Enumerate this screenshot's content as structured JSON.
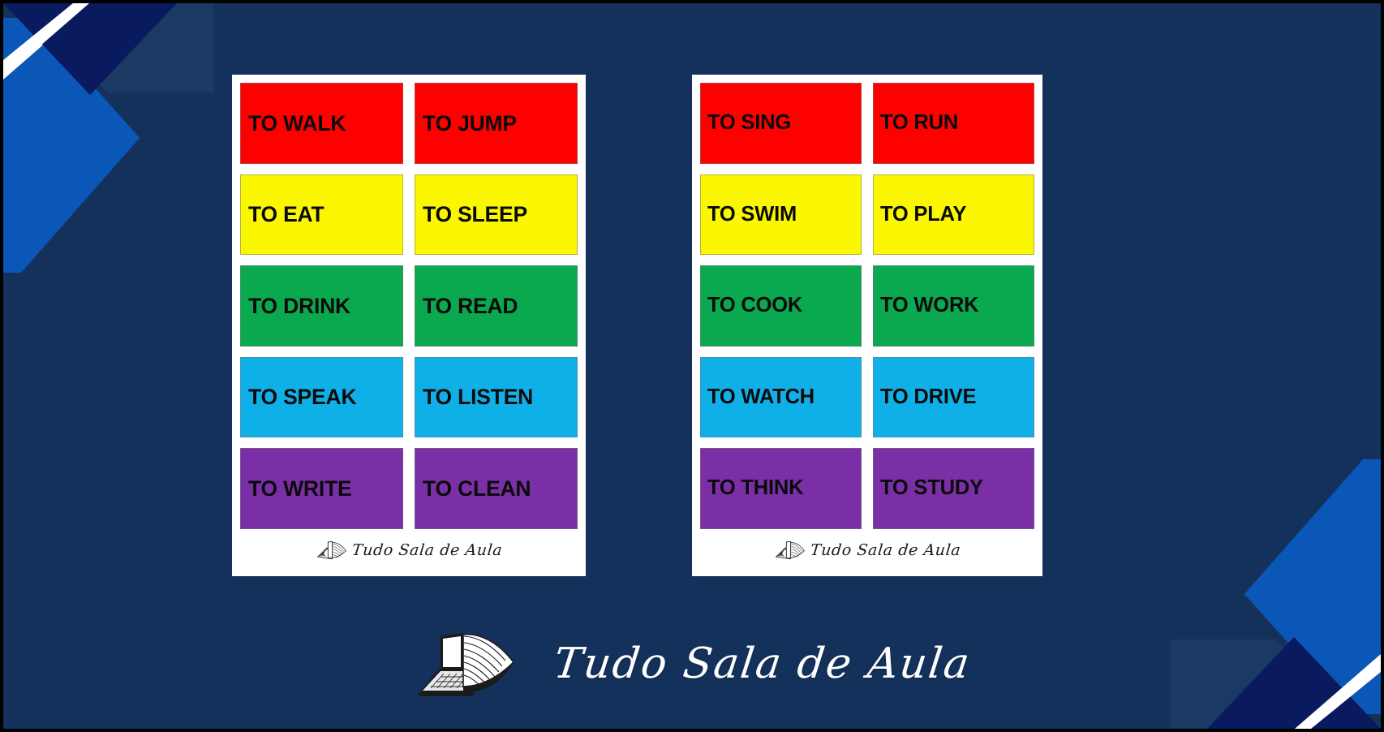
{
  "theme": {
    "background": "#14315c",
    "card_background": "#ffffff",
    "frame_border": "#000000",
    "corner_navy": "#0a1a5e",
    "corner_blue": "#0a57b8",
    "corner_white_stripe": "#ffffff",
    "corner_dark_panel": "#1b3a63"
  },
  "palette": {
    "red": "#ff0000",
    "yellow": "#fbf700",
    "green": "#0aa84f",
    "cyan": "#0fb0e8",
    "purple": "#7b2fa6"
  },
  "brand": {
    "name": "Tudo Sala de Aula",
    "logo_icon": "laptop-open-book-icon"
  },
  "cards": [
    {
      "id": "card-left",
      "watermark": {
        "text": "Tudo Sala de Aula",
        "icon": "open-book-icon"
      },
      "rows": [
        {
          "color": "red",
          "left": "TO WALK",
          "right": "TO JUMP"
        },
        {
          "color": "yellow",
          "left": "TO EAT",
          "right": "TO SLEEP"
        },
        {
          "color": "green",
          "left": "TO DRINK",
          "right": "TO READ"
        },
        {
          "color": "cyan",
          "left": "TO SPEAK",
          "right": "TO LISTEN"
        },
        {
          "color": "purple",
          "left": "TO WRITE",
          "right": "TO CLEAN"
        }
      ]
    },
    {
      "id": "card-right",
      "watermark": {
        "text": "Tudo Sala de Aula",
        "icon": "open-book-icon"
      },
      "rows": [
        {
          "color": "red",
          "left": "TO SING",
          "right": "TO RUN"
        },
        {
          "color": "yellow",
          "left": "TO SWIM",
          "right": "TO PLAY"
        },
        {
          "color": "green",
          "left": "TO COOK",
          "right": "TO WORK"
        },
        {
          "color": "cyan",
          "left": "TO WATCH",
          "right": "TO DRIVE"
        },
        {
          "color": "purple",
          "left": "TO THINK",
          "right": "TO STUDY"
        }
      ]
    }
  ],
  "cards_flat": {
    "left": {
      "t0l": "TO WALK",
      "t0r": "TO JUMP",
      "t1l": "TO EAT",
      "t1r": "TO SLEEP",
      "t2l": "TO DRINK",
      "t2r": "TO READ",
      "t3l": "TO SPEAK",
      "t3r": "TO LISTEN",
      "t4l": "TO WRITE",
      "t4r": "TO CLEAN",
      "wm": "Tudo Sala de Aula"
    },
    "right": {
      "t0l": "TO SING",
      "t0r": "TO RUN",
      "t1l": "TO SWIM",
      "t1r": "TO PLAY",
      "t2l": "TO COOK",
      "t2r": "TO WORK",
      "t3l": "TO WATCH",
      "t3r": "TO DRIVE",
      "t4l": "TO THINK",
      "t4r": "TO STUDY",
      "wm": "Tudo Sala de Aula"
    }
  }
}
